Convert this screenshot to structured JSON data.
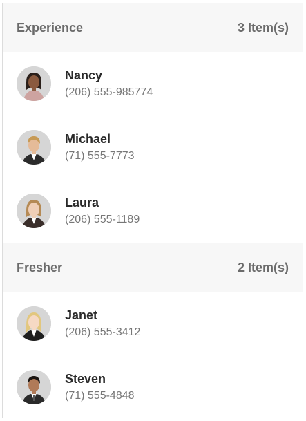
{
  "groups": [
    {
      "title": "Experience",
      "count": "3 Item(s)",
      "contacts": [
        {
          "name": "Nancy",
          "phone": "(206) 555-985774",
          "avatar": "woman-dark-hair-avatar"
        },
        {
          "name": "Michael",
          "phone": "(71) 555-7773",
          "avatar": "man-blond-hair-avatar"
        },
        {
          "name": "Laura",
          "phone": "(206) 555-1189",
          "avatar": "woman-light-hair-avatar"
        }
      ]
    },
    {
      "title": "Fresher",
      "count": "2 Item(s)",
      "contacts": [
        {
          "name": "Janet",
          "phone": "(206) 555-3412",
          "avatar": "woman-blonde-hair-avatar"
        },
        {
          "name": "Steven",
          "phone": "(71) 555-4848",
          "avatar": "man-dark-hair-avatar"
        }
      ]
    }
  ],
  "colors": {
    "header_bg": "#f7f7f7",
    "header_text": "#6b6b6b",
    "name_text": "#2a2a2a",
    "phone_text": "#777777",
    "border": "#dcdcdc"
  }
}
